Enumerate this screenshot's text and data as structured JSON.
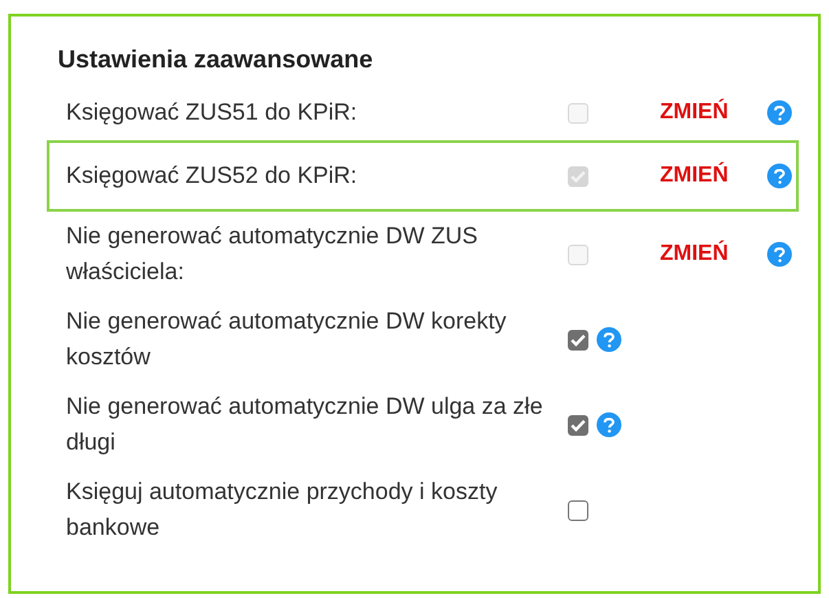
{
  "section": {
    "title": "Ustawienia zaawansowane"
  },
  "rows": [
    {
      "label": "Księgować ZUS51 do KPiR:",
      "checked": false,
      "disabled": true,
      "highlighted": false,
      "change_link": "ZMIEŃ",
      "help": true
    },
    {
      "label": "Księgować ZUS52 do KPiR:",
      "checked": true,
      "disabled": true,
      "highlighted": true,
      "change_link": "ZMIEŃ",
      "help": true
    },
    {
      "label": "Nie generować automatycznie DW ZUS właściciela:",
      "checked": false,
      "disabled": true,
      "highlighted": false,
      "change_link": "ZMIEŃ",
      "help": true
    },
    {
      "label": "Nie generować automatycznie DW korekty kosztów",
      "checked": true,
      "disabled": false,
      "highlighted": false,
      "help": true
    },
    {
      "label": "Nie generować automatycznie DW ulga za złe długi",
      "checked": true,
      "disabled": false,
      "highlighted": false,
      "help": true
    },
    {
      "label": "Księguj automatycznie przychody i koszty bankowe",
      "checked": false,
      "disabled": false,
      "highlighted": false,
      "help": false
    }
  ]
}
